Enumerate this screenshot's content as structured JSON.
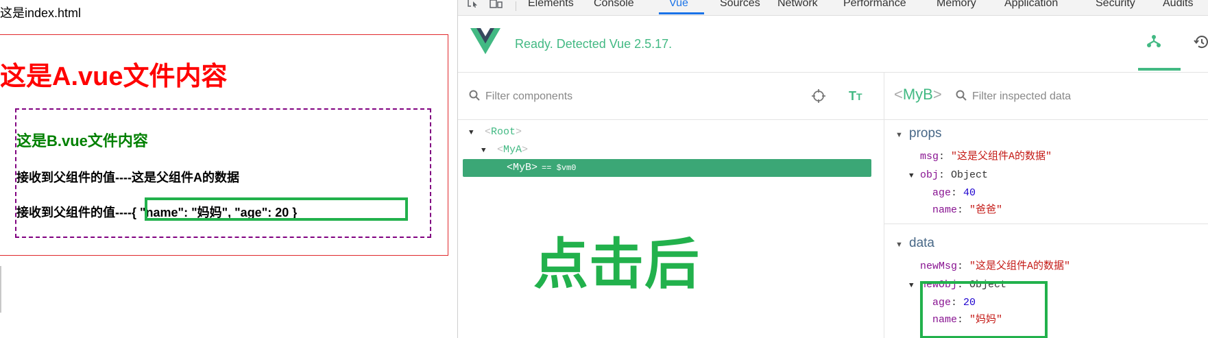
{
  "page": {
    "title": "这是index.html",
    "a_heading": "这是A.vue文件内容",
    "b_heading": "这是B.vue文件内容",
    "line1_prefix": "接收到父组件的值----",
    "line1_value": "这是父组件A的数据",
    "line2_prefix": "接收到父组件的值----",
    "line2_value": "{ \"name\": \"妈妈\", \"age\": 20 }"
  },
  "devtools": {
    "tabs": [
      {
        "label": "Elements"
      },
      {
        "label": "Console"
      },
      {
        "label": "Vue",
        "active": true
      },
      {
        "label": "Sources"
      },
      {
        "label": "Network"
      },
      {
        "label": "Performance"
      },
      {
        "label": "Memory"
      },
      {
        "label": "Application"
      },
      {
        "label": "Security"
      },
      {
        "label": "Audits"
      }
    ],
    "vue": {
      "ready_text": "Ready. Detected Vue 2.5.17.",
      "filter_components_placeholder": "Filter components",
      "filter_data_placeholder": "Filter inspected data",
      "tree": [
        {
          "name": "Root"
        },
        {
          "name": "MyA"
        },
        {
          "name": "MyB",
          "vm": "== $vm0",
          "selected": true
        }
      ],
      "selected_component": "MyB",
      "overlay_text": "点击后",
      "props_title": "props",
      "data_title": "data",
      "props": {
        "msg_key": "msg",
        "msg_value": "\"这是父组件A的数据\"",
        "obj_key": "obj",
        "obj_type": "Object",
        "obj_age_key": "age",
        "obj_age_value": "40",
        "obj_name_key": "name",
        "obj_name_value": "\"爸爸\""
      },
      "data": {
        "newMsg_key": "newMsg",
        "newMsg_value": "\"这是父组件A的数据\"",
        "newObj_key": "newObj",
        "newObj_type": "Object",
        "newObj_age_key": "age",
        "newObj_age_value": "20",
        "newObj_name_key": "name",
        "newObj_name_value": "\"妈妈\""
      }
    }
  },
  "colors": {
    "vue_green": "#42b983",
    "selected_row": "#3ba776",
    "highlight_box": "#22b14c",
    "a_heading": "#ff0000",
    "b_heading": "#008000"
  }
}
